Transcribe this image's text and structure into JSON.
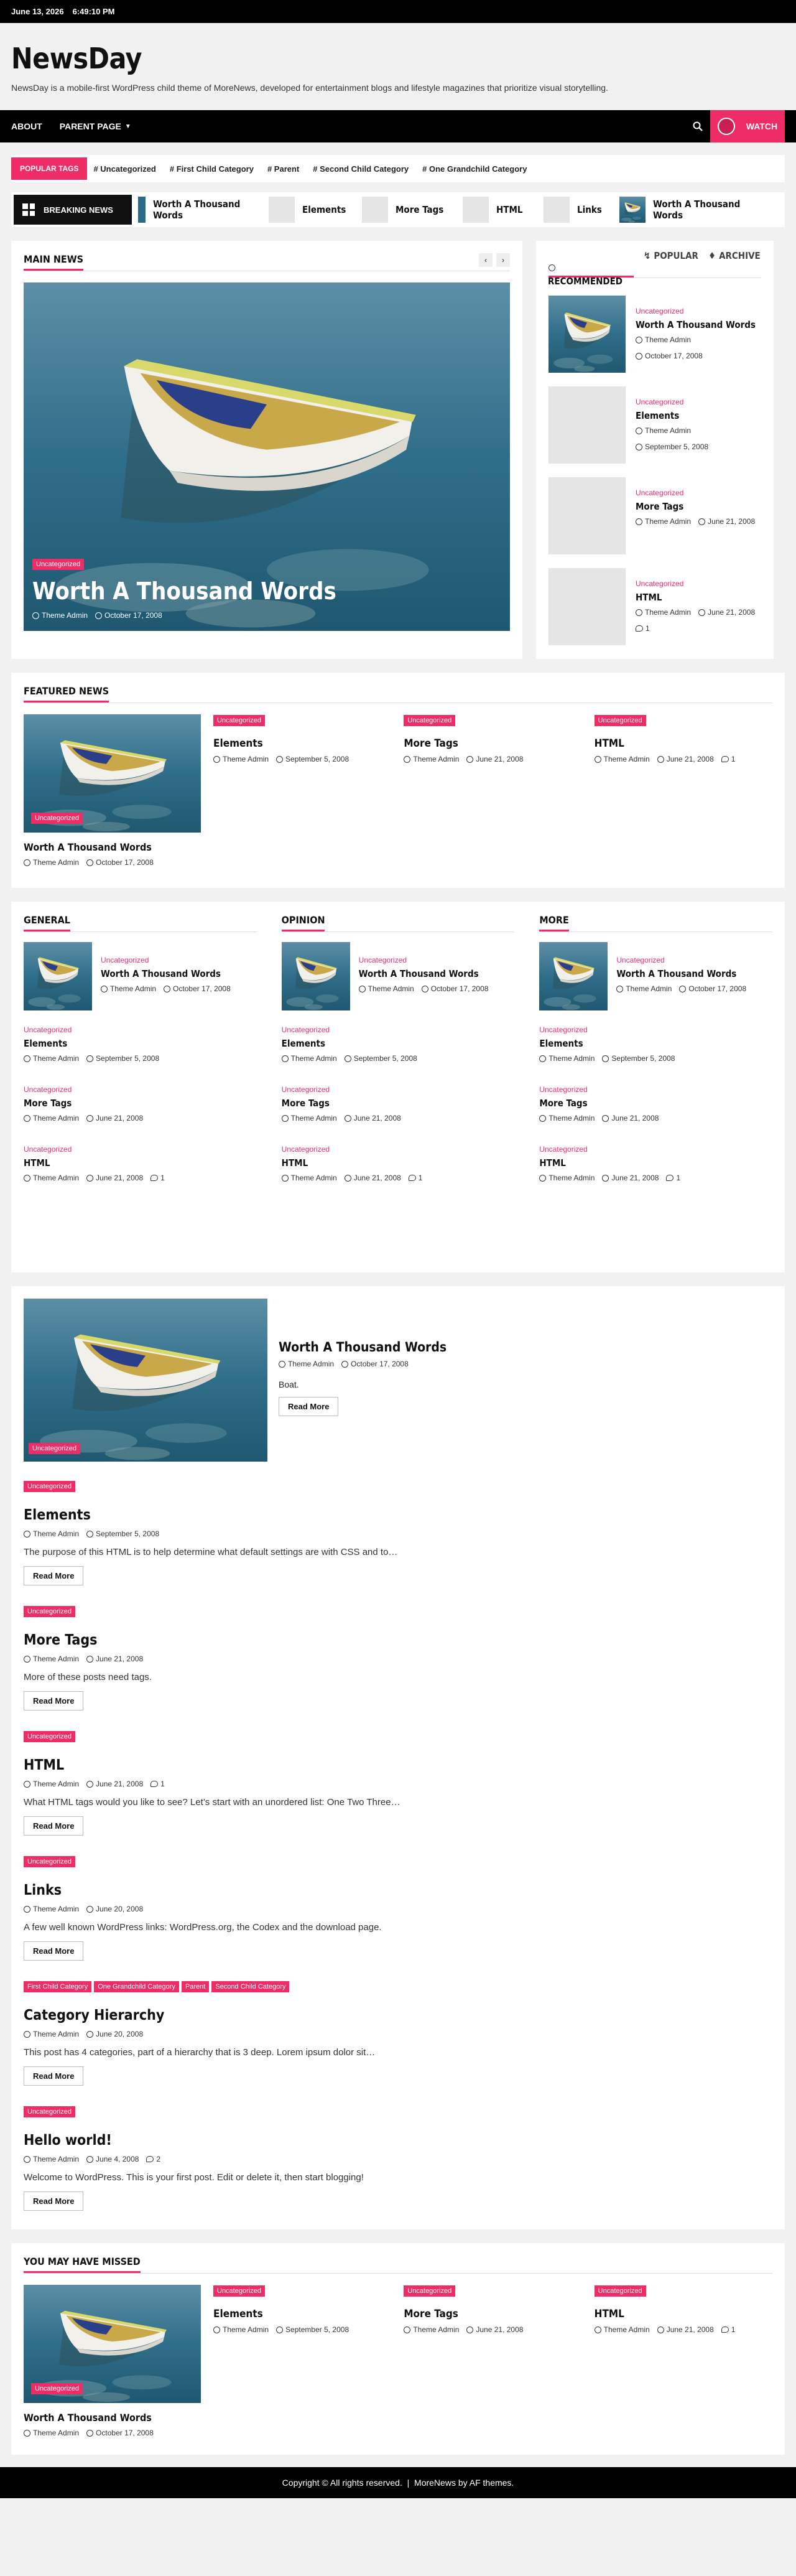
{
  "topbar": {
    "date": "June 13, 2026",
    "time": "6:49:10 PM"
  },
  "site": {
    "title": "NewsDay",
    "description": "NewsDay is a mobile-first WordPress child theme of MoreNews, developed for entertainment blogs and lifestyle magazines that prioritize visual storytelling."
  },
  "nav": {
    "items": [
      "About",
      "Parent Page"
    ],
    "watch_label": "Watch"
  },
  "popular_tags": {
    "label": "POPULAR TAGS",
    "tags": [
      "# Uncategorized",
      "# First Child Category",
      "# Parent",
      "# Second Child Category",
      "# One Grandchild Category"
    ]
  },
  "breaking": {
    "label": "BREAKING NEWS",
    "items": [
      "Worth A Thousand Words",
      "Elements",
      "More Tags",
      "HTML",
      "Links",
      "Worth A Thousand Words"
    ]
  },
  "main_news": {
    "title": "Main News",
    "hero": {
      "category": "Uncategorized",
      "title": "Worth A Thousand Words",
      "author": "Theme Admin",
      "date": "October 17, 2008"
    }
  },
  "side_tabs": {
    "recommended": "Recommended",
    "popular": "Popular",
    "archive": "Archive"
  },
  "side_posts": [
    {
      "category": "Uncategorized",
      "title": "Worth A Thousand Words",
      "author": "Theme Admin",
      "date": "October 17, 2008",
      "comments": ""
    },
    {
      "category": "Uncategorized",
      "title": "Elements",
      "author": "Theme Admin",
      "date": "September 5, 2008",
      "comments": ""
    },
    {
      "category": "Uncategorized",
      "title": "More Tags",
      "author": "Theme Admin",
      "date": "June 21, 2008",
      "comments": ""
    },
    {
      "category": "Uncategorized",
      "title": "HTML",
      "author": "Theme Admin",
      "date": "June 21, 2008",
      "comments": "1"
    }
  ],
  "featured": {
    "title": "Featured News",
    "big": {
      "category": "Uncategorized",
      "title": "Worth A Thousand Words",
      "author": "Theme Admin",
      "date": "October 17, 2008"
    },
    "items": [
      {
        "category": "Uncategorized",
        "title": "Elements",
        "author": "Theme Admin",
        "date": "September 5, 2008",
        "comments": ""
      },
      {
        "category": "Uncategorized",
        "title": "More Tags",
        "author": "Theme Admin",
        "date": "June 21, 2008",
        "comments": ""
      },
      {
        "category": "Uncategorized",
        "title": "HTML",
        "author": "Theme Admin",
        "date": "June 21, 2008",
        "comments": "1"
      }
    ]
  },
  "columns": [
    {
      "title": "General",
      "posts": [
        {
          "category": "Uncategorized",
          "title": "Worth A Thousand Words",
          "author": "Theme Admin",
          "date": "October 17, 2008",
          "comments": ""
        },
        {
          "category": "Uncategorized",
          "title": "Elements",
          "author": "Theme Admin",
          "date": "September 5, 2008",
          "comments": ""
        },
        {
          "category": "Uncategorized",
          "title": "More Tags",
          "author": "Theme Admin",
          "date": "June 21, 2008",
          "comments": ""
        },
        {
          "category": "Uncategorized",
          "title": "HTML",
          "author": "Theme Admin",
          "date": "June 21, 2008",
          "comments": "1"
        }
      ]
    },
    {
      "title": "Opinion",
      "posts": [
        {
          "category": "Uncategorized",
          "title": "Worth A Thousand Words",
          "author": "Theme Admin",
          "date": "October 17, 2008",
          "comments": ""
        },
        {
          "category": "Uncategorized",
          "title": "Elements",
          "author": "Theme Admin",
          "date": "September 5, 2008",
          "comments": ""
        },
        {
          "category": "Uncategorized",
          "title": "More Tags",
          "author": "Theme Admin",
          "date": "June 21, 2008",
          "comments": ""
        },
        {
          "category": "Uncategorized",
          "title": "HTML",
          "author": "Theme Admin",
          "date": "June 21, 2008",
          "comments": "1"
        }
      ]
    },
    {
      "title": "More",
      "posts": [
        {
          "category": "Uncategorized",
          "title": "Worth A Thousand Words",
          "author": "Theme Admin",
          "date": "October 17, 2008",
          "comments": ""
        },
        {
          "category": "Uncategorized",
          "title": "Elements",
          "author": "Theme Admin",
          "date": "September 5, 2008",
          "comments": ""
        },
        {
          "category": "Uncategorized",
          "title": "More Tags",
          "author": "Theme Admin",
          "date": "June 21, 2008",
          "comments": ""
        },
        {
          "category": "Uncategorized",
          "title": "HTML",
          "author": "Theme Admin",
          "date": "June 21, 2008",
          "comments": "1"
        }
      ]
    }
  ],
  "feed": {
    "read_more": "Read More",
    "top": {
      "category": "Uncategorized",
      "title": "Worth A Thousand Words",
      "author": "Theme Admin",
      "date": "October 17, 2008",
      "excerpt": "Boat."
    },
    "posts": [
      {
        "categories": [
          "Uncategorized"
        ],
        "title": "Elements",
        "author": "Theme Admin",
        "date": "September 5, 2008",
        "comments": "",
        "excerpt": "The purpose of this HTML is to help determine what default settings are with CSS and to…"
      },
      {
        "categories": [
          "Uncategorized"
        ],
        "title": "More Tags",
        "author": "Theme Admin",
        "date": "June 21, 2008",
        "comments": "",
        "excerpt": "More of these posts need tags."
      },
      {
        "categories": [
          "Uncategorized"
        ],
        "title": "HTML",
        "author": "Theme Admin",
        "date": "June 21, 2008",
        "comments": "1",
        "excerpt": "What HTML tags would you like to see? Let’s start with an unordered list: One Two Three…"
      },
      {
        "categories": [
          "Uncategorized"
        ],
        "title": "Links",
        "author": "Theme Admin",
        "date": "June 20, 2008",
        "comments": "",
        "excerpt": "A few well known WordPress links: WordPress.org, the Codex and the download page."
      },
      {
        "categories": [
          "First Child Category",
          "One Grandchild Category",
          "Parent",
          "Second Child Category"
        ],
        "title": "Category Hierarchy",
        "author": "Theme Admin",
        "date": "June 20, 2008",
        "comments": "",
        "excerpt": "This post has 4 categories, part of a hierarchy that is 3 deep. Lorem ipsum dolor sit…"
      },
      {
        "categories": [
          "Uncategorized"
        ],
        "title": "Hello world!",
        "author": "Theme Admin",
        "date": "June 4, 2008",
        "comments": "2",
        "excerpt": "Welcome to WordPress. This is your first post. Edit or delete it, then start blogging!"
      }
    ]
  },
  "missed": {
    "title": "You May Have Missed",
    "big": {
      "category": "Uncategorized",
      "title": "Worth A Thousand Words",
      "author": "Theme Admin",
      "date": "October 17, 2008"
    },
    "items": [
      {
        "category": "Uncategorized",
        "title": "Elements",
        "author": "Theme Admin",
        "date": "September 5, 2008",
        "comments": ""
      },
      {
        "category": "Uncategorized",
        "title": "More Tags",
        "author": "Theme Admin",
        "date": "June 21, 2008",
        "comments": ""
      },
      {
        "category": "Uncategorized",
        "title": "HTML",
        "author": "Theme Admin",
        "date": "June 21, 2008",
        "comments": "1"
      }
    ]
  },
  "footer": {
    "text": "Copyright © All rights reserved.  |  MoreNews by AF themes."
  },
  "colors": {
    "accent": "#ee2d67",
    "dark": "#000000"
  }
}
